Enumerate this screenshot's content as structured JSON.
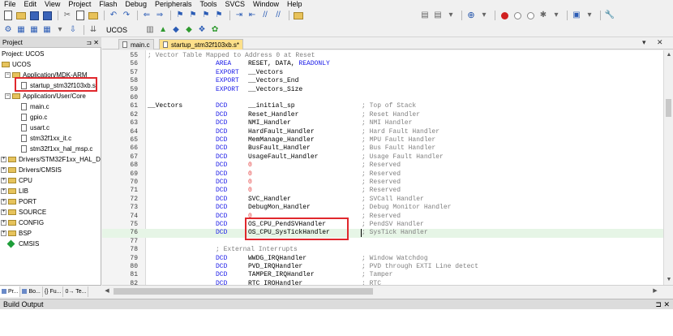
{
  "menu": [
    "File",
    "Edit",
    "View",
    "Project",
    "Flash",
    "Debug",
    "Peripherals",
    "Tools",
    "SVCS",
    "Window",
    "Help"
  ],
  "toolbar": {
    "target": "UCOS"
  },
  "project": {
    "title": "Project",
    "root": "Project: UCOS",
    "target": "UCOS",
    "groups": [
      {
        "label": "Application/MDK-ARM",
        "files": [
          "startup_stm32f103xb.s"
        ]
      },
      {
        "label": "Application/User/Core",
        "files": [
          "main.c",
          "gpio.c",
          "usart.c",
          "stm32f1xx_it.c",
          "stm32f1xx_hal_msp.c"
        ]
      },
      {
        "label": "Drivers/STM32F1xx_HAL_Driv"
      },
      {
        "label": "Drivers/CMSIS"
      },
      {
        "label": "CPU"
      },
      {
        "label": "LIB"
      },
      {
        "label": "PORT"
      },
      {
        "label": "SOURCE"
      },
      {
        "label": "CONFIG"
      },
      {
        "label": "BSP"
      }
    ],
    "cmsis": "CMSIS",
    "tabs": [
      "Pr...",
      "Bo...",
      "{} Fu...",
      "0→ Te..."
    ]
  },
  "editor": {
    "tabs": [
      {
        "label": "main.c"
      },
      {
        "label": "startup_stm32f103xb.s*"
      }
    ],
    "lines": [
      {
        "num": 55,
        "comment_full": "; Vector Table Mapped to Address 0 at Reset"
      },
      {
        "num": 56,
        "kw": "AREA",
        "arg": "RESET, DATA, ",
        "ro": "READONLY"
      },
      {
        "num": 57,
        "kw": "EXPORT",
        "arg": "__Vectors"
      },
      {
        "num": 58,
        "kw": "EXPORT",
        "arg": "__Vectors_End"
      },
      {
        "num": 59,
        "kw": "EXPORT",
        "arg": "__Vectors_Size"
      },
      {
        "num": 60
      },
      {
        "num": 61,
        "label": "__Vectors",
        "kw": "DCD",
        "arg": "__initial_sp",
        "comment": "; Top of Stack"
      },
      {
        "num": 62,
        "kw": "DCD",
        "arg": "Reset_Handler",
        "comment": "; Reset Handler"
      },
      {
        "num": 63,
        "kw": "DCD",
        "arg": "NMI_Handler",
        "comment": "; NMI Handler"
      },
      {
        "num": 64,
        "kw": "DCD",
        "arg": "HardFault_Handler",
        "comment": "; Hard Fault Handler"
      },
      {
        "num": 65,
        "kw": "DCD",
        "arg": "MemManage_Handler",
        "comment": "; MPU Fault Handler"
      },
      {
        "num": 66,
        "kw": "DCD",
        "arg": "BusFault_Handler",
        "comment": "; Bus Fault Handler"
      },
      {
        "num": 67,
        "kw": "DCD",
        "arg": "UsageFault_Handler",
        "comment": "; Usage Fault Handler"
      },
      {
        "num": 68,
        "kw": "DCD",
        "zero": "0",
        "comment": "; Reserved"
      },
      {
        "num": 69,
        "kw": "DCD",
        "zero": "0",
        "comment": "; Reserved"
      },
      {
        "num": 70,
        "kw": "DCD",
        "zero": "0",
        "comment": "; Reserved"
      },
      {
        "num": 71,
        "kw": "DCD",
        "zero": "0",
        "comment": "; Reserved"
      },
      {
        "num": 72,
        "kw": "DCD",
        "arg": "SVC_Handler",
        "comment": "; SVCall Handler"
      },
      {
        "num": 73,
        "kw": "DCD",
        "arg": "DebugMon_Handler",
        "comment": "; Debug Monitor Handler"
      },
      {
        "num": 74,
        "kw": "DCD",
        "zero": "0",
        "comment": "; Reserved"
      },
      {
        "num": 75,
        "kw": "DCD",
        "arg": "OS_CPU_PendSVHandler",
        "comment": "; PendSV Handler"
      },
      {
        "num": 76,
        "kw": "DCD",
        "arg": "OS_CPU_SysTickHandler",
        "comment": "; SysTick Handler"
      },
      {
        "num": 77
      },
      {
        "num": 78,
        "comment_sub": "; External Interrupts"
      },
      {
        "num": 79,
        "kw": "DCD",
        "arg": "WWDG_IRQHandler",
        "comment": "; Window Watchdog"
      },
      {
        "num": 80,
        "kw": "DCD",
        "arg": "PVD_IRQHandler",
        "comment": "; PVD through EXTI Line detect"
      },
      {
        "num": 81,
        "kw": "DCD",
        "arg": "TAMPER_IRQHandler",
        "comment": "; Tamper"
      },
      {
        "num": 82,
        "kw": "DCD",
        "arg": "RTC_IRQHandler",
        "comment": "; RTC"
      }
    ]
  },
  "build": {
    "title": "Build Output"
  }
}
